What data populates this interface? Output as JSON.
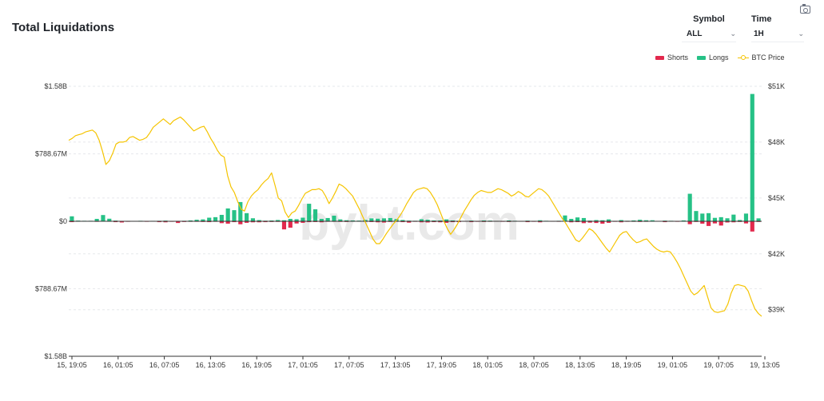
{
  "header": {
    "title": "Total Liquidations"
  },
  "controls": {
    "symbol": {
      "label": "Symbol",
      "value": "ALL"
    },
    "time": {
      "label": "Time",
      "value": "1H"
    }
  },
  "icons": {
    "screenshot": "camera-icon",
    "dropdown": "chevron-down-icon"
  },
  "colors": {
    "shorts": "#e2294d",
    "longs": "#26c186",
    "price": "#f5c400",
    "grid": "#e6e8ec"
  },
  "watermark": "bybt.com",
  "chart_data": {
    "type": "bar",
    "legend": [
      "Shorts",
      "Longs",
      "BTC Price"
    ],
    "legend_position": "top-right",
    "grid": true,
    "x_tick_labels": [
      "15, 19:05",
      "16, 01:05",
      "16, 07:05",
      "16, 13:05",
      "16, 19:05",
      "17, 01:05",
      "17, 07:05",
      "17, 13:05",
      "17, 19:05",
      "18, 01:05",
      "18, 07:05",
      "18, 13:05",
      "18, 19:05",
      "19, 01:05",
      "19, 07:05",
      "19, 13:05"
    ],
    "y_left": {
      "ylim": [
        -1.58,
        1.58
      ],
      "unit": "B USD",
      "tick_labels": [
        "$1.58B",
        "$788.67M",
        "$0",
        "$788.67M",
        "$1.58B"
      ]
    },
    "y_right": {
      "ylim": [
        36.5,
        51
      ],
      "unit": "K USD",
      "tick_labels": [
        "$51K",
        "$48K",
        "$45K",
        "$42K",
        "$39K"
      ],
      "tick_values": [
        51,
        48,
        45,
        42,
        39
      ]
    },
    "longs_m": [
      58,
      8,
      6,
      6,
      28,
      73,
      30,
      8,
      4,
      5,
      4,
      6,
      3,
      5,
      6,
      8,
      4,
      5,
      6,
      10,
      18,
      22,
      42,
      48,
      75,
      150,
      130,
      225,
      95,
      35,
      14,
      7,
      9,
      15,
      12,
      28,
      24,
      42,
      205,
      140,
      28,
      38,
      65,
      22,
      12,
      10,
      8,
      16,
      34,
      30,
      34,
      38,
      26,
      15,
      8,
      6,
      24,
      18,
      10,
      10,
      22,
      10,
      6,
      4,
      8,
      4,
      10,
      8,
      5,
      4,
      10,
      6,
      4,
      8,
      5,
      12,
      6,
      4,
      6,
      68,
      28,
      45,
      38,
      8,
      14,
      12,
      22,
      5,
      14,
      6,
      10,
      18,
      12,
      12,
      2,
      8,
      6,
      4,
      10,
      322,
      120,
      90,
      95,
      40,
      48,
      35,
      78,
      15,
      90,
      1490,
      34
    ],
    "shorts_m": [
      10,
      5,
      4,
      4,
      6,
      4,
      5,
      10,
      14,
      6,
      4,
      5,
      6,
      4,
      10,
      12,
      6,
      20,
      8,
      6,
      6,
      8,
      10,
      6,
      22,
      28,
      10,
      35,
      18,
      12,
      12,
      10,
      8,
      7,
      95,
      75,
      26,
      18,
      10,
      9,
      12,
      6,
      6,
      7,
      8,
      5,
      5,
      6,
      9,
      12,
      15,
      8,
      6,
      10,
      16,
      6,
      12,
      14,
      10,
      12,
      18,
      10,
      10,
      5,
      10,
      6,
      8,
      6,
      5,
      6,
      8,
      5,
      5,
      10,
      6,
      12,
      4,
      5,
      6,
      5,
      12,
      10,
      22,
      16,
      20,
      28,
      18,
      6,
      12,
      6,
      6,
      8,
      6,
      4,
      3,
      10,
      5,
      6,
      4,
      34,
      8,
      28,
      55,
      25,
      50,
      14,
      12,
      8,
      25,
      120,
      8
    ],
    "price_k": [
      48.1,
      48.2,
      48.35,
      48.4,
      48.45,
      48.55,
      48.6,
      48.65,
      48.5,
      48.1,
      47.5,
      46.8,
      47,
      47.4,
      47.9,
      48,
      48,
      48.05,
      48.25,
      48.3,
      48.2,
      48.1,
      48.15,
      48.25,
      48.5,
      48.8,
      48.95,
      49.1,
      49.25,
      49.1,
      48.95,
      49.15,
      49.25,
      49.35,
      49.2,
      49,
      48.8,
      48.6,
      48.7,
      48.8,
      48.85,
      48.55,
      48.2,
      47.9,
      47.55,
      47.3,
      47.2,
      46.2,
      45.6,
      45.3,
      44.8,
      44.4,
      44.3,
      44.8,
      45.1,
      45.3,
      45.45,
      45.7,
      45.9,
      46.05,
      46.35,
      45.7,
      45,
      44.85,
      44.25,
      43.95,
      44.2,
      44.3,
      44.6,
      44.95,
      45.25,
      45.35,
      45.45,
      45.45,
      45.5,
      45.4,
      45.1,
      44.7,
      45,
      45.35,
      45.75,
      45.65,
      45.5,
      45.3,
      45.1,
      44.75,
      44.4,
      44,
      43.6,
      43.2,
      42.8,
      42.55,
      42.55,
      42.8,
      43.1,
      43.35,
      43.6,
      43.8,
      44.05,
      44.35,
      44.7,
      45,
      45.3,
      45.45,
      45.5,
      45.55,
      45.5,
      45.3,
      45,
      44.65,
      44.2,
      43.75,
      43.35,
      43.05,
      43.3,
      43.6,
      43.95,
      44.3,
      44.6,
      44.9,
      45.15,
      45.3,
      45.4,
      45.35,
      45.3,
      45.3,
      45.4,
      45.5,
      45.45,
      45.35,
      45.25,
      45.1,
      45.2,
      45.35,
      45.25,
      45.1,
      45.05,
      45.2,
      45.35,
      45.5,
      45.45,
      45.3,
      45.1,
      44.8,
      44.5,
      44.2,
      43.9,
      43.65,
      43.35,
      43.05,
      42.75,
      42.65,
      42.85,
      43.1,
      43.35,
      43.25,
      43.05,
      42.8,
      42.55,
      42.3,
      42.1,
      42.4,
      42.7,
      43,
      43.15,
      43.2,
      42.95,
      42.75,
      42.6,
      42.65,
      42.75,
      42.8,
      42.6,
      42.4,
      42.25,
      42.15,
      42.1,
      42.15,
      42.1,
      41.85,
      41.55,
      41.2,
      40.8,
      40.4,
      40,
      39.8,
      39.9,
      40.1,
      40.3,
      39.7,
      39.1,
      38.9,
      38.85,
      38.9,
      38.95,
      39.3,
      39.9,
      40.3,
      40.35,
      40.3,
      40.25,
      40,
      39.5,
      39.05,
      38.8,
      38.65
    ]
  }
}
